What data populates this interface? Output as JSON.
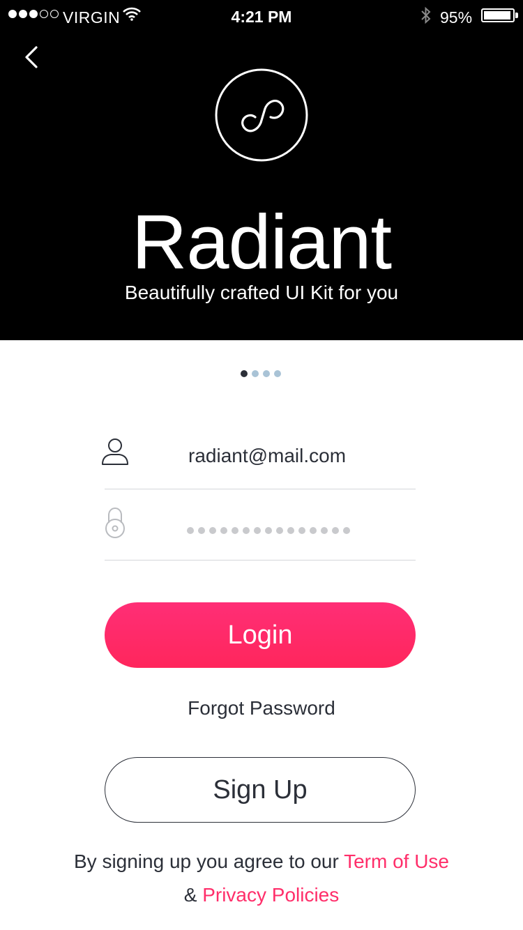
{
  "status_bar": {
    "signal_dots": [
      "full",
      "full",
      "full",
      "empty",
      "empty"
    ],
    "carrier": "VIRGIN",
    "time": "4:21 PM",
    "battery_percent": "95%",
    "battery_level": 0.95
  },
  "brand": {
    "title": "Radiant",
    "tagline": "Beautifully crafted UI Kit for you"
  },
  "pager": {
    "count": 4,
    "active": 0
  },
  "form": {
    "email_value": "radiant@mail.com",
    "password_mask_count": 15
  },
  "buttons": {
    "login": "Login",
    "forgot": "Forgot Password",
    "signup": "Sign Up"
  },
  "terms": {
    "prefix": "By signing up you agree to our ",
    "term_link": "Term of Use",
    "amp": "& ",
    "privacy_link": "Privacy Policies"
  },
  "colors": {
    "accent": "#ff2e6a",
    "hero_bg": "#000000",
    "text": "#2b2f38",
    "pager_inactive": "#a9c3d6"
  },
  "icons": [
    "back-chevron-icon",
    "logo-infinity-icon",
    "user-icon",
    "lock-icon",
    "wifi-icon",
    "bluetooth-icon",
    "battery-icon"
  ]
}
